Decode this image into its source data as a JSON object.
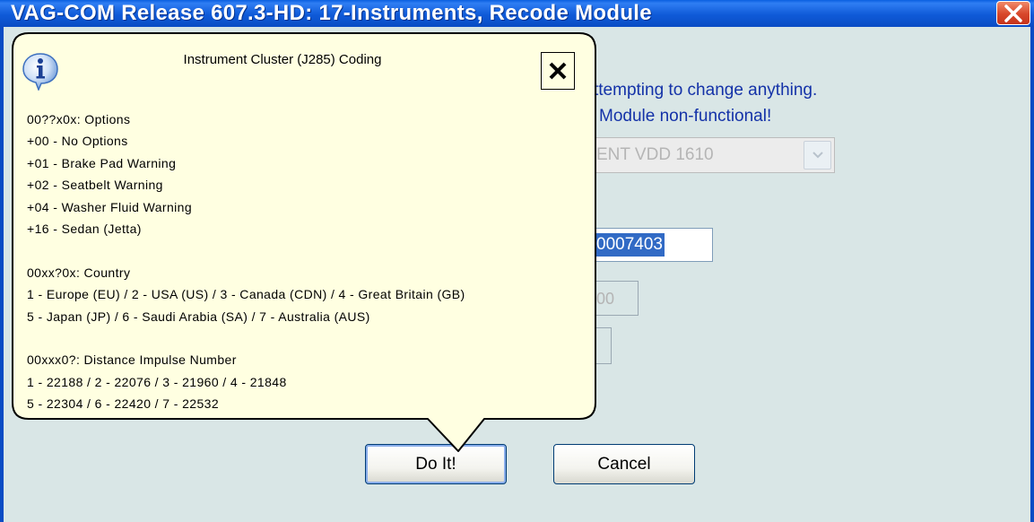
{
  "window": {
    "title": "VAG-COM Release 607.3-HD: 17-Instruments,  Recode Module"
  },
  "background": {
    "warning_line1": "ttempting to change anything.",
    "warning_line2": "Module non-functional!",
    "component_combo_value": "ENT VDD 1610",
    "coding_value": "0007403",
    "workshop_value": "00",
    "do_it_label": "Do It!",
    "cancel_label": "Cancel"
  },
  "balloon": {
    "title": "Instrument Cluster (J285) Coding",
    "lines": [
      "00??x0x: Options",
      "+00 - No Options",
      "+01 - Brake Pad Warning",
      "+02 - Seatbelt Warning",
      "+04 - Washer Fluid Warning",
      "+16 - Sedan (Jetta)",
      "",
      "00xx?0x: Country",
      "1 - Europe (EU) / 2 - USA (US) / 3 - Canada (CDN) / 4 - Great Britain (GB)",
      "5 - Japan (JP) / 6 - Saudi Arabia (SA) / 7 - Australia (AUS)",
      "",
      "00xxx0?: Distance Impulse Number",
      "1 - 22188 / 2 - 22076 / 3 - 21960 / 4 - 21848",
      "5 - 22304 / 6 - 22420 / 7 - 22532"
    ],
    "info_icon": "info-icon",
    "close_icon": "close-icon"
  },
  "colors": {
    "titlebar": "#0a5fe0",
    "client_bg": "#d9e6e6",
    "balloon_bg": "#ffffe1",
    "warning_text": "#1432a8",
    "selection": "#316ac5"
  }
}
